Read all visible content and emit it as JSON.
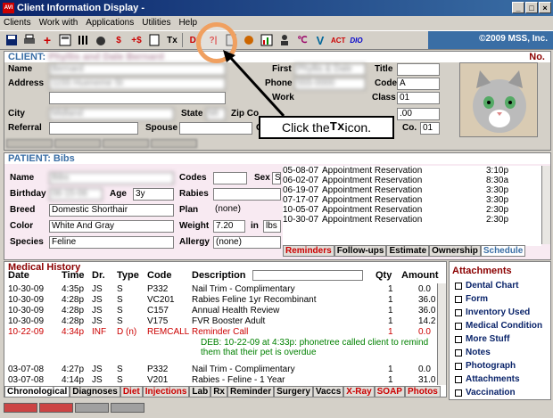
{
  "window": {
    "title": "Client Information Display -"
  },
  "menu": [
    "Clients",
    "Work with",
    "Applications",
    "Utilities",
    "Help"
  ],
  "toolbar": {
    "buttons": [
      "save-icon",
      "printer-icon",
      "plus-icon",
      "calculator-icon",
      "bars-icon",
      "cat-icon",
      "$",
      "+$",
      "notepad-icon",
      "Tx",
      "Dx",
      "?|",
      "list-icon",
      "paint-icon",
      "chart-icon",
      "person-icon",
      "chart-bars-icon",
      "V",
      "ACT",
      "DIO"
    ],
    "copyright": "©2009 MSS, Inc."
  },
  "client": {
    "header": "CLIENT:",
    "header_name": "Phyllis and Dale Bernard",
    "number_label": "No.",
    "labels": {
      "name": "Name",
      "first": "First",
      "title": "Title",
      "address": "Address",
      "phone": "Phone",
      "codes": "Codes",
      "work": "Work",
      "class": "Class",
      "city": "City",
      "state": "State",
      "zip": "Zip Co",
      "referral": "Referral",
      "spouse": "Spouse",
      "c": "C",
      "co": "Co."
    },
    "values": {
      "codes": "A",
      "class": "01",
      "amount": ".00",
      "co": "01"
    }
  },
  "patient": {
    "header": "PATIENT: Bibs",
    "labels": {
      "name": "Name",
      "birthday": "Birthday",
      "breed": "Breed",
      "color": "Color",
      "species": "Species",
      "codes": "Codes",
      "sex": "Sex",
      "rabies": "Rabies",
      "plan": "Plan",
      "weight": "Weight",
      "in": "in",
      "allergy": "Allergy",
      "age": "Age"
    },
    "values": {
      "name": "Bibs",
      "age": "3y",
      "breed": "Domestic Shorthair",
      "color": "White And Gray",
      "species": "Feline",
      "sex": "S",
      "plan": "(none)",
      "weight": "7.20",
      "weight_unit": "lbs",
      "allergy": "(none)"
    }
  },
  "schedule": [
    {
      "date": "05-08-07",
      "desc": "Appointment Reservation",
      "time": "3:10p"
    },
    {
      "date": "06-02-07",
      "desc": "Appointment Reservation",
      "time": "8:30a"
    },
    {
      "date": "06-19-07",
      "desc": "Appointment Reservation",
      "time": "3:30p"
    },
    {
      "date": "07-17-07",
      "desc": "Appointment Reservation",
      "time": "3:30p"
    },
    {
      "date": "10-05-07",
      "desc": "Appointment Reservation",
      "time": "2:30p"
    },
    {
      "date": "10-30-07",
      "desc": "Appointment Reservation",
      "time": "2:30p"
    }
  ],
  "patient_tabs": [
    "Reminders",
    "Follow-ups",
    "Estimate",
    "Ownership",
    "Schedule"
  ],
  "history": {
    "title": "Medical History",
    "headers": [
      "Date",
      "Time",
      "Dr.",
      "Type",
      "Code",
      "Description",
      "Qty",
      "Amount"
    ],
    "rows": [
      {
        "date": "10-30-09",
        "time": "4:35p",
        "dr": "JS",
        "type": "S",
        "code": "P332",
        "desc": "Nail Trim - Complimentary",
        "qty": "1",
        "amount": "0.0"
      },
      {
        "date": "10-30-09",
        "time": "4:28p",
        "dr": "JS",
        "type": "S",
        "code": "VC201",
        "desc": "Rabies Feline 1yr Recombinant",
        "qty": "1",
        "amount": "36.0"
      },
      {
        "date": "10-30-09",
        "time": "4:28p",
        "dr": "JS",
        "type": "S",
        "code": "C157",
        "desc": "Annual Health Review",
        "qty": "1",
        "amount": "36.0"
      },
      {
        "date": "10-30-09",
        "time": "4:28p",
        "dr": "JS",
        "type": "S",
        "code": "V175",
        "desc": "FVR  Booster Adult",
        "qty": "1",
        "amount": "14.2"
      },
      {
        "date": "10-22-09",
        "time": "4:34p",
        "dr": "INF",
        "type": "D (n)",
        "code": "REMCALL",
        "desc": "Reminder Call",
        "qty": "1",
        "amount": "0.0"
      },
      {
        "date": "03-07-08",
        "time": "4:27p",
        "dr": "JS",
        "type": "S",
        "code": "P332",
        "desc": "Nail Trim - Complimentary",
        "qty": "1",
        "amount": "0.0"
      },
      {
        "date": "03-07-08",
        "time": "4:14p",
        "dr": "JS",
        "type": "S",
        "code": "V201",
        "desc": "Rabies - Feline - 1 Year",
        "qty": "1",
        "amount": "31.0"
      }
    ],
    "note_line1": "DEB: 10-22-09 at 4:33p:  phonetree called client to remind",
    "note_line2": "them that their pet is overdue"
  },
  "history_tabs": [
    "Chronological",
    "Diagnoses",
    "Diet",
    "Injections",
    "Lab",
    "Rx",
    "Reminder",
    "Surgery",
    "Vaccs",
    "X-Ray",
    "SOAP",
    "Photos"
  ],
  "attachments": {
    "title": "Attachments",
    "items": [
      "Dental Chart",
      "Form",
      "Inventory Used",
      "Medical Condition",
      "More Stuff",
      "Notes",
      "Photograph",
      "Attachments",
      "Vaccination"
    ]
  },
  "callout": {
    "text_pre": "Click the ",
    "icon": "Tx",
    "text_post": " icon."
  }
}
